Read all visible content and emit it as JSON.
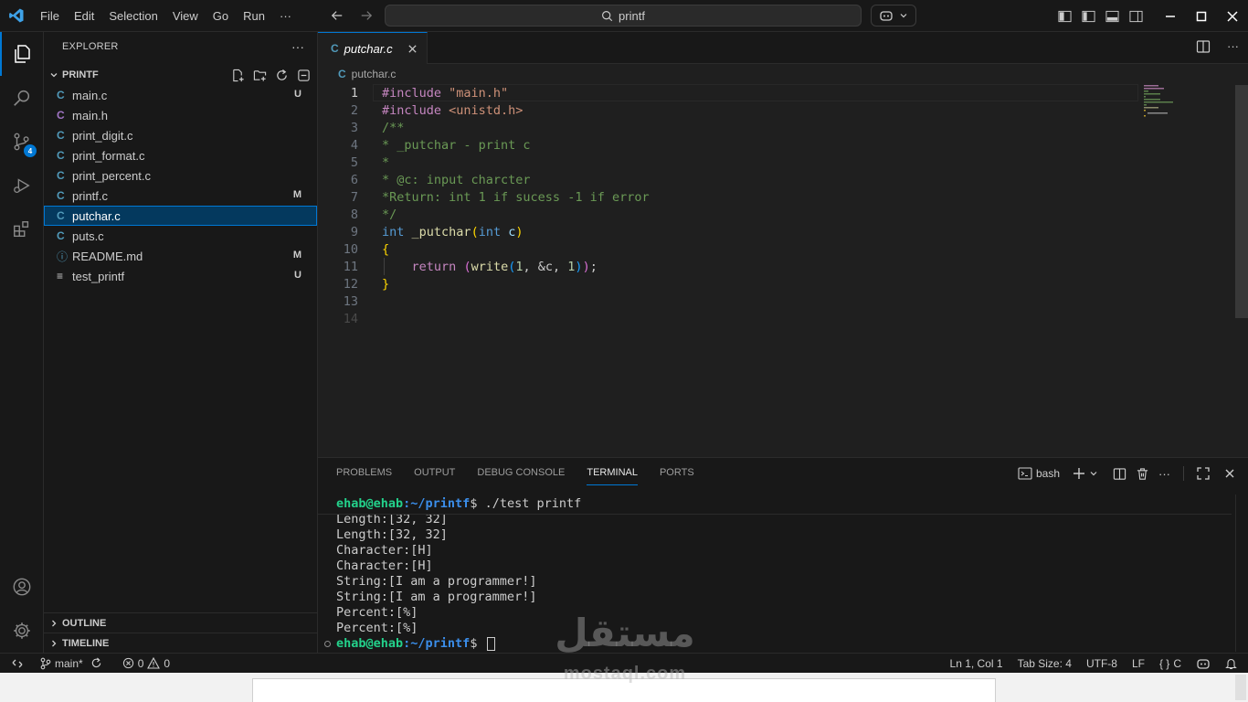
{
  "menu": [
    "File",
    "Edit",
    "Selection",
    "View",
    "Go",
    "Run",
    "···"
  ],
  "search": {
    "text": "printf"
  },
  "activity": {
    "scm_badge": "4"
  },
  "sidebar": {
    "title": "EXPLORER",
    "more": "···",
    "folder": "PRINTF",
    "files": [
      {
        "name": "main.c",
        "icon": "C",
        "status": "U"
      },
      {
        "name": "main.h",
        "icon": "C",
        "status": ""
      },
      {
        "name": "print_digit.c",
        "icon": "C",
        "status": ""
      },
      {
        "name": "print_format.c",
        "icon": "C",
        "status": ""
      },
      {
        "name": "print_percent.c",
        "icon": "C",
        "status": ""
      },
      {
        "name": "printf.c",
        "icon": "C",
        "status": "M"
      },
      {
        "name": "putchar.c",
        "icon": "C",
        "status": ""
      },
      {
        "name": "puts.c",
        "icon": "C",
        "status": ""
      },
      {
        "name": "README.md",
        "icon": "ⓘ",
        "status": "M"
      },
      {
        "name": "test_printf",
        "icon": "≡",
        "status": "U"
      }
    ],
    "outline": "OUTLINE",
    "timeline": "TIMELINE"
  },
  "editor": {
    "tab": "putchar.c",
    "breadcrumb": "putchar.c",
    "line_numbers": [
      "1",
      "2",
      "3",
      "4",
      "5",
      "6",
      "7",
      "8",
      "9",
      "10",
      "11",
      "12",
      "13",
      "14"
    ],
    "code": {
      "l1a": "#include ",
      "l1b": "\"main.h\"",
      "l2a": "#include ",
      "l2b": "<unistd.h>",
      "l3": "/**",
      "l4": "* _putchar - print c",
      "l5": "*",
      "l6": "* @c: input charcter",
      "l7": "*Return: int 1 if sucess -1 if error",
      "l8": "*/",
      "l9a": "int",
      "l9b": "_putchar",
      "l9c": "(",
      "l9d": "int",
      "l9e": "c",
      "l9f": ")",
      "l10": "{",
      "l11a": "return",
      "l11b": "(",
      "l11c": "write",
      "l11d": "(",
      "l11e": "1",
      "l11f": ", &c, ",
      "l11g": "1",
      "l11h": ")",
      "l11i": ")",
      "l11j": ";",
      "l12": "}"
    }
  },
  "panel": {
    "tabs": [
      "PROBLEMS",
      "OUTPUT",
      "DEBUG CONSOLE",
      "TERMINAL",
      "PORTS"
    ],
    "shell": "bash",
    "prompt_user": "ehab@ehab",
    "prompt_path": ":~/printf",
    "prompt_sym": "$ ",
    "command": "./test printf",
    "output": [
      "Length:[32, 32]",
      "Length:[32, 32]",
      "Character:[H]",
      "Character:[H]",
      "String:[I am a programmer!]",
      "String:[I am a programmer!]",
      "Percent:[%]",
      "Percent:[%]"
    ]
  },
  "status": {
    "branch": "main*",
    "errors": "0",
    "warnings": "0",
    "position": "Ln 1, Col 1",
    "tab_size": "Tab Size: 4",
    "encoding": "UTF-8",
    "eol": "LF",
    "language": "C"
  },
  "watermark": {
    "arabic": "مستقل",
    "latin": "mostaql.com"
  },
  "colors": {
    "accent": "#0078d4",
    "background": "#1f1f1f",
    "sidebar": "#181818"
  }
}
